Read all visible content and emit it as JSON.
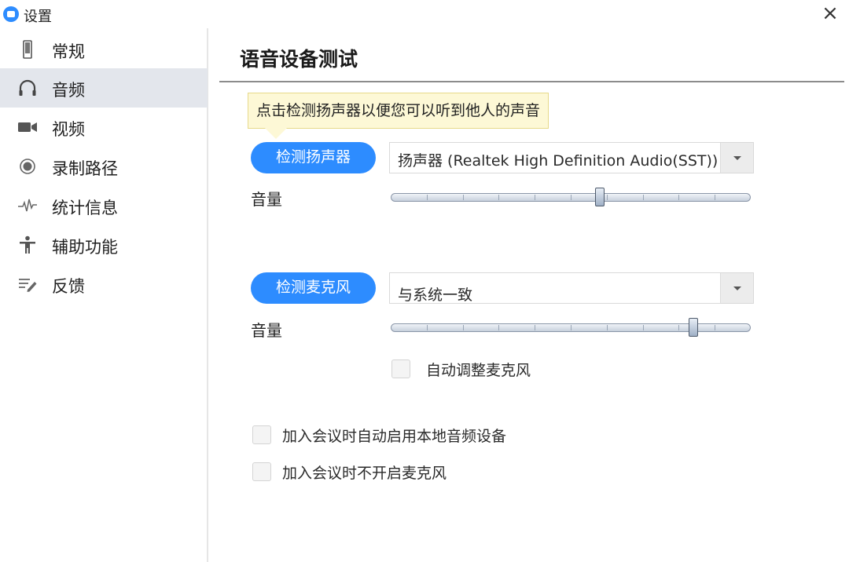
{
  "window": {
    "title": "设置",
    "logo_icon": "zoom-camera-logo",
    "close_glyph": "×",
    "accent": "#2d8cff"
  },
  "sidebar": {
    "items": [
      {
        "label": "常规",
        "icon": "phone-general-icon",
        "active": false
      },
      {
        "label": "音频",
        "icon": "headphones-icon",
        "active": true
      },
      {
        "label": "视频",
        "icon": "video-camera-icon",
        "active": false
      },
      {
        "label": "录制路径",
        "icon": "record-icon",
        "active": false
      },
      {
        "label": "统计信息",
        "icon": "pulse-icon",
        "active": false
      },
      {
        "label": "辅助功能",
        "icon": "accessibility-icon",
        "active": false
      },
      {
        "label": "反馈",
        "icon": "feedback-icon",
        "active": false
      }
    ]
  },
  "main": {
    "title": "语音设备测试",
    "speaker": {
      "tooltip": "点击检测扬声器以便您可以听到他人的声音",
      "test_button": "检测扬声器",
      "device": "扬声器 (Realtek High Definition Audio(SST))",
      "volume_label": "音量",
      "volume_fraction": 0.58
    },
    "microphone": {
      "test_button": "检测麦克风",
      "device": "与系统一致",
      "volume_label": "音量",
      "volume_fraction": 0.84,
      "auto_adjust_label": "自动调整麦克风",
      "auto_adjust_checked": false
    },
    "options": [
      {
        "label": "加入会议时自动启用本地音频设备",
        "checked": false
      },
      {
        "label": "加入会议时不开启麦克风",
        "checked": false
      }
    ]
  }
}
